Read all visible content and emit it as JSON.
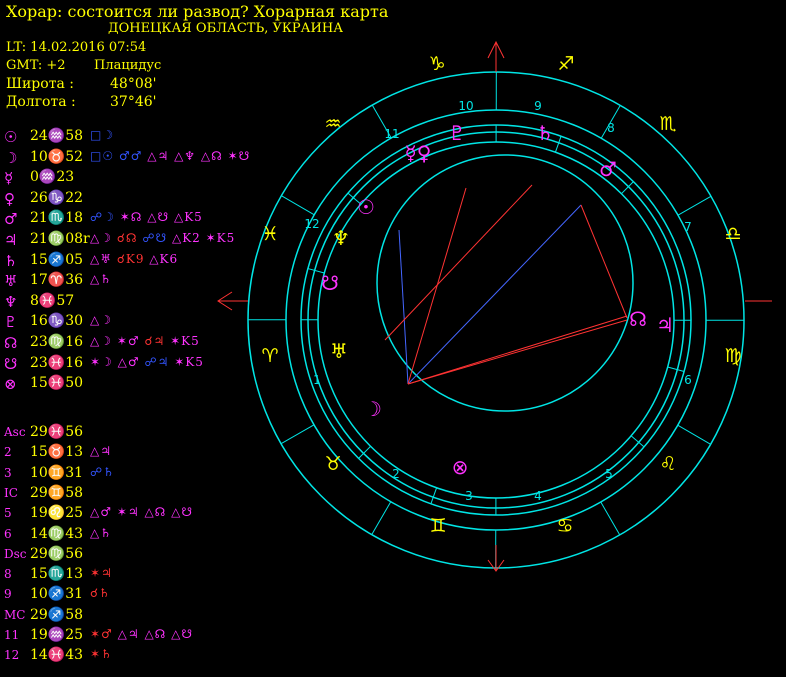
{
  "header": {
    "title": "Хорар: состоится ли развод? Хорарная карта",
    "location": "ДОНЕЦКАЯ ОБЛАСТЬ, УКРАИНА",
    "lt": "LT: 14.02.2016  07:54",
    "gmt": "GMT: +2",
    "house_system": "Плацидус",
    "latitude_label": "Широта :",
    "latitude_value": "48°08'",
    "longitude_label": "Долгота :",
    "longitude_value": "37°46'"
  },
  "planets": [
    {
      "glyph": "☉",
      "pos": "24♒58",
      "aspects": [
        {
          "t": "□☽",
          "c": "b"
        }
      ]
    },
    {
      "glyph": "☽",
      "pos": "10♉52",
      "aspects": [
        {
          "t": "□☉",
          "c": "b"
        },
        {
          "t": "♂♂",
          "c": "b"
        },
        {
          "t": "△♃",
          "c": "m"
        },
        {
          "t": "△♆",
          "c": "m"
        },
        {
          "t": "△☊",
          "c": "m"
        },
        {
          "t": "✶☋",
          "c": "m"
        }
      ]
    },
    {
      "glyph": "☿",
      "pos": "0♒23",
      "aspects": []
    },
    {
      "glyph": "♀",
      "pos": "26♑22",
      "aspects": []
    },
    {
      "glyph": "♂",
      "pos": "21♏18",
      "aspects": [
        {
          "t": "☍☽",
          "c": "b"
        },
        {
          "t": "✶☊",
          "c": "m"
        },
        {
          "t": "△☋",
          "c": "m"
        },
        {
          "t": "△K5",
          "c": "m"
        }
      ]
    },
    {
      "glyph": "♃",
      "pos": "21♍08r",
      "aspects": [
        {
          "t": "△☽",
          "c": "m"
        },
        {
          "t": "☌☊",
          "c": "r"
        },
        {
          "t": "☍☋",
          "c": "b"
        },
        {
          "t": "△K2",
          "c": "m"
        },
        {
          "t": "✶K5",
          "c": "m"
        }
      ]
    },
    {
      "glyph": "♄",
      "pos": "15♐05",
      "aspects": [
        {
          "t": "△♅",
          "c": "m"
        },
        {
          "t": "☌K9",
          "c": "r"
        },
        {
          "t": "△K6",
          "c": "m"
        }
      ]
    },
    {
      "glyph": "♅",
      "pos": "17♈36",
      "aspects": [
        {
          "t": "△♄",
          "c": "m"
        }
      ]
    },
    {
      "glyph": "♆",
      "pos": "8♓57",
      "aspects": []
    },
    {
      "glyph": "♇",
      "pos": "16♑30",
      "aspects": [
        {
          "t": "△☽",
          "c": "m"
        }
      ]
    },
    {
      "glyph": "☊",
      "pos": "23♍16",
      "aspects": [
        {
          "t": "△☽",
          "c": "m"
        },
        {
          "t": "✶♂",
          "c": "m"
        },
        {
          "t": "☌♃",
          "c": "r"
        },
        {
          "t": "✶K5",
          "c": "m"
        }
      ]
    },
    {
      "glyph": "☋",
      "pos": "23♓16",
      "aspects": [
        {
          "t": "✶☽",
          "c": "m"
        },
        {
          "t": "△♂",
          "c": "m"
        },
        {
          "t": "☍♃",
          "c": "b"
        },
        {
          "t": "✶K5",
          "c": "m"
        }
      ]
    },
    {
      "glyph": "⊗",
      "pos": "15♓50",
      "aspects": []
    }
  ],
  "houses": [
    {
      "label": "Asc",
      "pos": "29♓56",
      "aspects": []
    },
    {
      "label": "2",
      "pos": "15♉13",
      "aspects": [
        {
          "t": "△♃",
          "c": "m"
        }
      ]
    },
    {
      "label": "3",
      "pos": "10♊31",
      "aspects": [
        {
          "t": "☍♄",
          "c": "b"
        }
      ]
    },
    {
      "label": "IC",
      "pos": "29♊58",
      "aspects": []
    },
    {
      "label": "5",
      "pos": "19♌25",
      "aspects": [
        {
          "t": "△♂",
          "c": "m"
        },
        {
          "t": "✶♃",
          "c": "m"
        },
        {
          "t": "△☊",
          "c": "m"
        },
        {
          "t": "△☋",
          "c": "m"
        }
      ]
    },
    {
      "label": "6",
      "pos": "14♍43",
      "aspects": [
        {
          "t": "△♄",
          "c": "m"
        }
      ]
    },
    {
      "label": "Dsc",
      "pos": "29♍56",
      "aspects": []
    },
    {
      "label": "8",
      "pos": "15♏13",
      "aspects": [
        {
          "t": "✶♃",
          "c": "r"
        }
      ]
    },
    {
      "label": "9",
      "pos": "10♐31",
      "aspects": [
        {
          "t": "☌♄",
          "c": "r"
        }
      ]
    },
    {
      "label": "MC",
      "pos": "29♐58",
      "aspects": []
    },
    {
      "label": "11",
      "pos": "19♒25",
      "aspects": [
        {
          "t": "✶♂",
          "c": "r"
        },
        {
          "t": "△♃",
          "c": "m"
        },
        {
          "t": "△☊",
          "c": "m"
        },
        {
          "t": "△☋",
          "c": "m"
        }
      ]
    },
    {
      "label": "12",
      "pos": "14♓43",
      "aspects": [
        {
          "t": "✶♄",
          "c": "r"
        }
      ]
    }
  ],
  "wheel": {
    "signs": [
      "♈",
      "♉",
      "♊",
      "♋",
      "♌",
      "♍",
      "♎",
      "♏",
      "♐",
      "♑",
      "♒",
      "♓"
    ],
    "house_numbers": [
      "1",
      "2",
      "3",
      "4",
      "5",
      "6",
      "7",
      "8",
      "9",
      "10",
      "11",
      "12"
    ],
    "planet_glyphs": [
      {
        "g": "☉",
        "name": "sun"
      },
      {
        "g": "♆",
        "name": "neptune"
      },
      {
        "g": "☋",
        "name": "south-node"
      },
      {
        "g": "♅",
        "name": "uranus"
      },
      {
        "g": "☽",
        "name": "moon"
      },
      {
        "g": "⊗",
        "name": "part-of-fortune"
      },
      {
        "g": "☊",
        "name": "north-node"
      },
      {
        "g": "♃",
        "name": "jupiter"
      },
      {
        "g": "♂",
        "name": "mars"
      },
      {
        "g": "♄",
        "name": "saturn"
      },
      {
        "g": "♇",
        "name": "pluto"
      },
      {
        "g": "☿♀",
        "name": "mercury-venus"
      }
    ]
  }
}
